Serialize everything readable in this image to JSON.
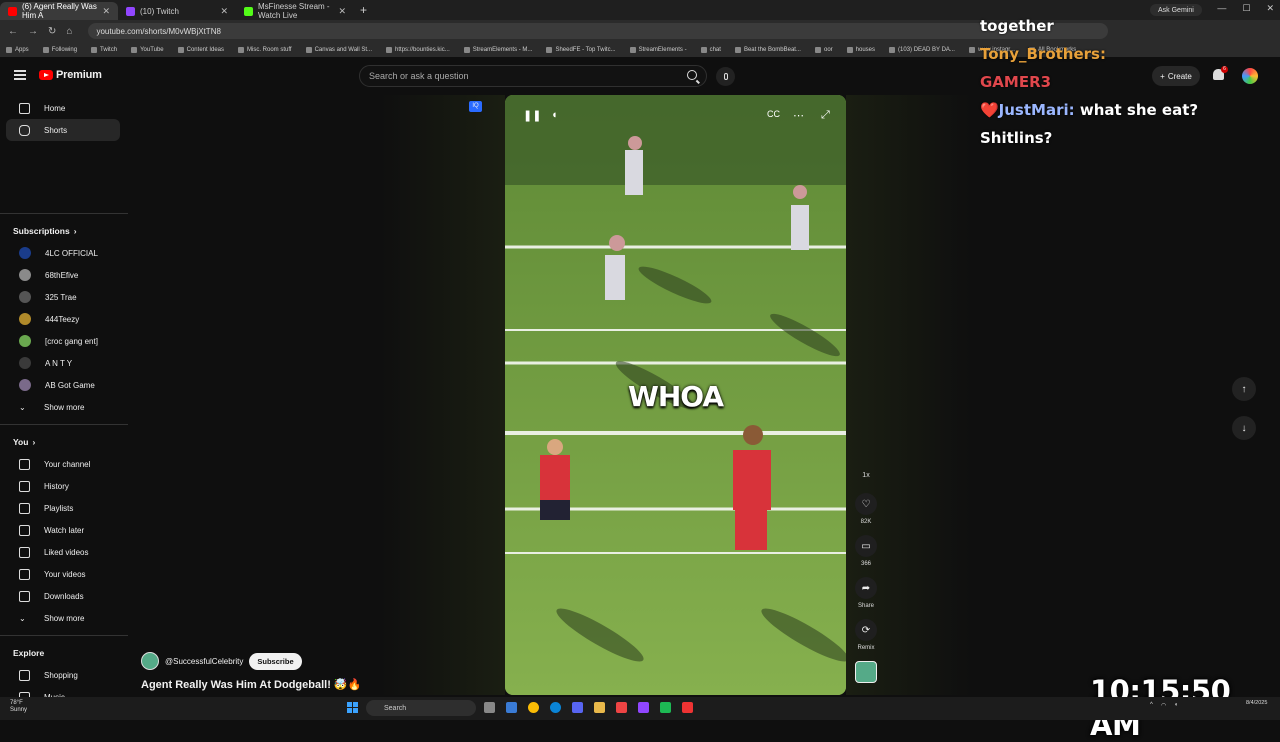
{
  "browser": {
    "tabs": [
      {
        "label": "(6) Agent Really Was Him A",
        "active": true,
        "color": "#ff0000"
      },
      {
        "label": "(10) Twitch",
        "active": false,
        "color": "#9146ff"
      },
      {
        "label": "MsFinesse Stream - Watch Live",
        "active": false,
        "color": "#53fc18"
      }
    ],
    "ask_label": "Ask Gemini",
    "url": "youtube.com/shorts/M0vWBjXtTN8",
    "bookmarks": [
      "Apps",
      "Following",
      "Twitch",
      "YouTube",
      "Content Ideas",
      "Misc. Room stuff",
      "Canvas and Wall St...",
      "https://bounties.kic...",
      "StreamElements - M...",
      "SheedFE - Top Twitc...",
      "StreamElements -",
      "chat",
      "Beat the BombBeat...",
      "oor",
      "houses",
      "(103) DEAD BY DA...",
      "www.instagr...",
      "All Bookmarks"
    ]
  },
  "youtube": {
    "logo_label": "Premium",
    "search_placeholder": "Search or ask a question",
    "create_label": "Create",
    "bell_badge": "6",
    "sidebar": {
      "top": [
        {
          "label": "Home",
          "icon": "home-icon"
        },
        {
          "label": "Shorts",
          "icon": "shorts-icon",
          "active": true
        }
      ],
      "subscriptions_title": "Subscriptions",
      "subscriptions": [
        {
          "label": "4LC OFFICIAL",
          "color": "#1a3c8a"
        },
        {
          "label": "68thEfive",
          "color": "#8a8a8a"
        },
        {
          "label": "325 Trae",
          "color": "#555555"
        },
        {
          "label": "444Teezy",
          "color": "#b08a2a"
        },
        {
          "label": "[croc gang ent]",
          "color": "#6aa84f"
        },
        {
          "label": "A N T Y",
          "color": "#3a3a3a"
        },
        {
          "label": "AB Got Game",
          "color": "#7a6a8a"
        }
      ],
      "subs_more": "Show more",
      "you_title": "You",
      "you_items": [
        {
          "label": "Your channel",
          "icon": "channel-icon"
        },
        {
          "label": "History",
          "icon": "history-icon"
        },
        {
          "label": "Playlists",
          "icon": "playlists-icon"
        },
        {
          "label": "Watch later",
          "icon": "clock-icon"
        },
        {
          "label": "Liked videos",
          "icon": "like-icon"
        },
        {
          "label": "Your videos",
          "icon": "video-icon"
        },
        {
          "label": "Downloads",
          "icon": "download-icon"
        }
      ],
      "you_more": "Show more",
      "explore_title": "Explore",
      "explore_items": [
        {
          "label": "Shopping",
          "icon": "bag-icon"
        },
        {
          "label": "Music",
          "icon": "music-icon"
        }
      ]
    },
    "short": {
      "overlay_text": "WHOA",
      "channel": "@SuccessfulCelebrity",
      "subscribe": "Subscribe",
      "title": "Agent Really Was Him At Dodgeball! 🤯🔥",
      "speed": "1x",
      "actions": [
        {
          "icon": "like-icon",
          "label": "82K"
        },
        {
          "icon": "comment-icon",
          "label": "366"
        },
        {
          "icon": "share-icon",
          "label": "Share"
        },
        {
          "icon": "remix-icon",
          "label": "Remix"
        }
      ]
    }
  },
  "overlay": {
    "chat_lines": [
      {
        "user": "",
        "text": "together"
      },
      {
        "user": "Tony_Brothers:",
        "text": ""
      },
      {
        "user": "GAMER3",
        "text": ""
      },
      {
        "user": "❤️JustMari:",
        "text": " what she eat?"
      },
      {
        "user": "",
        "text": "Shitlins?"
      }
    ],
    "clock": "10:15:50 AM"
  },
  "taskbar": {
    "weather_temp": "78°F",
    "weather_desc": "Sunny",
    "search_label": "Search",
    "date_line1": "8/4/2025"
  }
}
